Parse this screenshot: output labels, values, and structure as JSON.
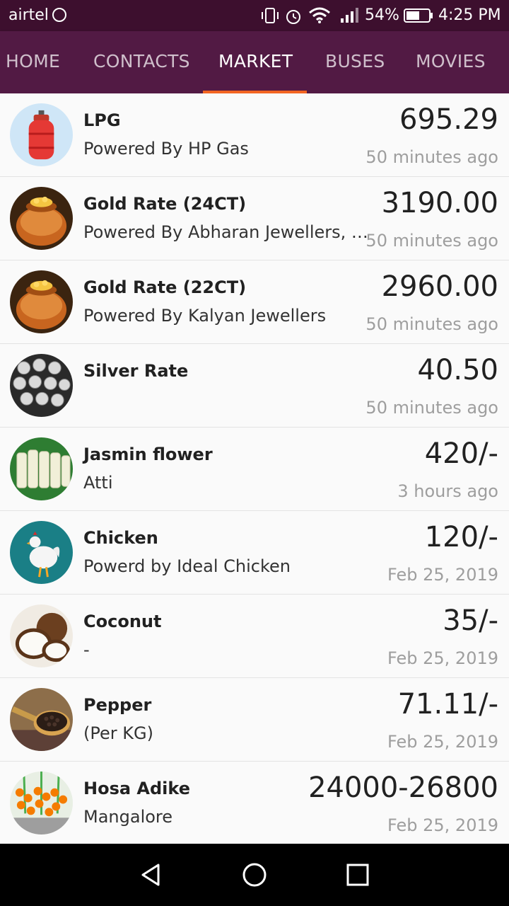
{
  "status": {
    "carrier": "airtel",
    "battery": "54%",
    "time": "4:25 PM"
  },
  "tabs": [
    {
      "label": "HOME"
    },
    {
      "label": "CONTACTS"
    },
    {
      "label": "MARKET",
      "active": true
    },
    {
      "label": "BUSES"
    },
    {
      "label": "MOVIES"
    }
  ],
  "accent_color": "#f26522",
  "items": [
    {
      "icon": "lpg-cylinder-icon",
      "title": "LPG",
      "subtitle": "Powered By HP Gas",
      "value": "695.29",
      "time": "50 minutes ago"
    },
    {
      "icon": "gold-pot-icon",
      "title": "Gold Rate (24CT)",
      "subtitle": "Powered By Abharan Jewellers, Mangalore",
      "value": "3190.00",
      "time": "50 minutes ago"
    },
    {
      "icon": "gold-pot-icon",
      "title": "Gold Rate (22CT)",
      "subtitle": "Powered By Kalyan Jewellers",
      "value": "2960.00",
      "time": "50 minutes ago"
    },
    {
      "icon": "silver-bowls-icon",
      "title": "Silver Rate",
      "subtitle": "",
      "value": "40.50",
      "time": "50 minutes ago"
    },
    {
      "icon": "jasmine-flower-icon",
      "title": "Jasmin flower",
      "subtitle": "Atti",
      "value": "420/-",
      "time": "3 hours ago"
    },
    {
      "icon": "chicken-icon",
      "title": "Chicken",
      "subtitle": "Powerd by Ideal Chicken",
      "value": "120/-",
      "time": "Feb 25, 2019"
    },
    {
      "icon": "coconut-icon",
      "title": "Coconut",
      "subtitle": "-",
      "value": "35/-",
      "time": "Feb 25, 2019"
    },
    {
      "icon": "pepper-icon",
      "title": "Pepper",
      "subtitle": "(Per KG)",
      "value": "71.11/-",
      "time": "Feb 25, 2019"
    },
    {
      "icon": "arecanut-icon",
      "title": "Hosa Adike",
      "subtitle": "Mangalore",
      "value": "24000-26800",
      "time": "Feb 25, 2019"
    }
  ]
}
